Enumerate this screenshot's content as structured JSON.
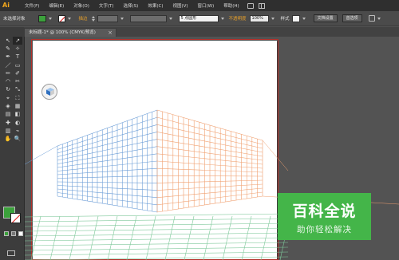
{
  "app": {
    "logo": "Ai"
  },
  "menu": {
    "items": [
      "文件(F)",
      "编辑(E)",
      "对象(O)",
      "文字(T)",
      "选择(S)",
      "效果(C)",
      "视图(V)",
      "窗口(W)",
      "帮助(H)"
    ]
  },
  "control": {
    "selection_label": "未选择对象",
    "stroke_label": "描边",
    "brush_field": "5 点圆形",
    "opacity_label": "不透明度",
    "opacity_value": "100%",
    "style_label": "样式",
    "doc_setup_button": "文档设置",
    "preferences_button": "首选项",
    "fill_color": "#3ca13c"
  },
  "tab": {
    "title": "未标题-1* @ 100% (CMYK/预览)",
    "close": "×"
  },
  "tools": {
    "icons": [
      "↖",
      "↗",
      "✎",
      "✧",
      "✒",
      "T",
      "／",
      "▭",
      "✏",
      "✐",
      "◠",
      "✂",
      "↻",
      "⤡",
      "⌖",
      "⛶",
      "◈",
      "▦",
      "▤",
      "◧",
      "✚",
      "◐",
      "▥",
      "⌁",
      "✋",
      "🔍"
    ]
  },
  "watermark": {
    "title": "百科全说",
    "subtitle": "助你轻松解决"
  },
  "colors": {
    "left_grid": "#6a9cd6",
    "right_grid": "#f0a070",
    "ground_grid": "#7ec89a",
    "bleed": "#b3302a"
  }
}
